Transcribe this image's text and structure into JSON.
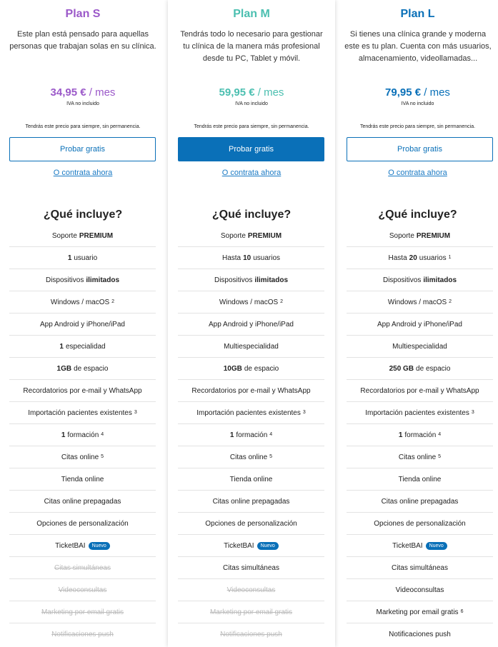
{
  "plans": [
    {
      "key": "s",
      "name": "Plan S",
      "color": "#9b59c9",
      "description_lines": [
        "Este plan está pensado para aquellas",
        "personas que trabajan solas en su clínica."
      ],
      "price": "34,95 €",
      "price_suffix": " / mes",
      "vat": "IVA no incluido",
      "forever": "Tendrás este precio para siempre, sin permanencia.",
      "cta": "Probar gratis",
      "cta_filled": false,
      "contract_link": "O contrata ahora",
      "includes_title": "¿Qué incluye?",
      "features": [
        {
          "pre": "Soporte",
          "bold": "PREMIUM",
          "post": "",
          "sup": "",
          "badge": "",
          "disabled": false
        },
        {
          "pre": "",
          "bold": "1",
          "post": "usuario",
          "sup": "",
          "badge": "",
          "disabled": false
        },
        {
          "pre": "Dispositivos",
          "bold": "ilimitados",
          "post": "",
          "sup": "",
          "badge": "",
          "disabled": false
        },
        {
          "pre": "Windows / macOS",
          "bold": "",
          "post": "",
          "sup": "2",
          "badge": "",
          "disabled": false
        },
        {
          "pre": "App Android y iPhone/iPad",
          "bold": "",
          "post": "",
          "sup": "",
          "badge": "",
          "disabled": false
        },
        {
          "pre": "",
          "bold": "1",
          "post": "especialidad",
          "sup": "",
          "badge": "",
          "disabled": false
        },
        {
          "pre": "",
          "bold": "1GB",
          "post": "de espacio",
          "sup": "",
          "badge": "",
          "disabled": false
        },
        {
          "pre": "Recordatorios por e-mail y WhatsApp",
          "bold": "",
          "post": "",
          "sup": "",
          "badge": "",
          "disabled": false
        },
        {
          "pre": "Importación pacientes existentes",
          "bold": "",
          "post": "",
          "sup": "3",
          "badge": "",
          "disabled": false
        },
        {
          "pre": "",
          "bold": "1",
          "post": "formación",
          "sup": "4",
          "badge": "",
          "disabled": false
        },
        {
          "pre": "Citas online",
          "bold": "",
          "post": "",
          "sup": "5",
          "badge": "",
          "disabled": false
        },
        {
          "pre": "Tienda online",
          "bold": "",
          "post": "",
          "sup": "",
          "badge": "",
          "disabled": false
        },
        {
          "pre": "Citas online prepagadas",
          "bold": "",
          "post": "",
          "sup": "",
          "badge": "",
          "disabled": false
        },
        {
          "pre": "Opciones de personalización",
          "bold": "",
          "post": "",
          "sup": "",
          "badge": "",
          "disabled": false
        },
        {
          "pre": "TicketBAI",
          "bold": "",
          "post": "",
          "sup": "",
          "badge": "Nuevo",
          "disabled": false
        },
        {
          "pre": "Citas simultáneas",
          "bold": "",
          "post": "",
          "sup": "",
          "badge": "",
          "disabled": true
        },
        {
          "pre": "Videoconsultas",
          "bold": "",
          "post": "",
          "sup": "",
          "badge": "",
          "disabled": true
        },
        {
          "pre": "Marketing por email gratis",
          "bold": "",
          "post": "",
          "sup": "",
          "badge": "",
          "disabled": true
        },
        {
          "pre": "Notificaciones push",
          "bold": "",
          "post": "",
          "sup": "",
          "badge": "",
          "disabled": true
        }
      ]
    },
    {
      "key": "m",
      "name": "Plan M",
      "color": "#4bbfb0",
      "description_lines": [
        "Tendrás todo lo necesario para gestionar",
        "tu clínica de la manera más profesional",
        "desde tu PC, Tablet y móvil."
      ],
      "price": "59,95 €",
      "price_suffix": " / mes",
      "vat": "IVA no incluido",
      "forever": "Tendrás este precio para siempre, sin permanencia.",
      "cta": "Probar gratis",
      "cta_filled": true,
      "contract_link": "O contrata ahora",
      "includes_title": "¿Qué incluye?",
      "features": [
        {
          "pre": "Soporte",
          "bold": "PREMIUM",
          "post": "",
          "sup": "",
          "badge": "",
          "disabled": false
        },
        {
          "pre": "Hasta",
          "bold": "10",
          "post": "usuarios",
          "sup": "",
          "badge": "",
          "disabled": false
        },
        {
          "pre": "Dispositivos",
          "bold": "ilimitados",
          "post": "",
          "sup": "",
          "badge": "",
          "disabled": false
        },
        {
          "pre": "Windows / macOS",
          "bold": "",
          "post": "",
          "sup": "2",
          "badge": "",
          "disabled": false
        },
        {
          "pre": "App Android y iPhone/iPad",
          "bold": "",
          "post": "",
          "sup": "",
          "badge": "",
          "disabled": false
        },
        {
          "pre": "Multiespecialidad",
          "bold": "",
          "post": "",
          "sup": "",
          "badge": "",
          "disabled": false
        },
        {
          "pre": "",
          "bold": "10GB",
          "post": "de espacio",
          "sup": "",
          "badge": "",
          "disabled": false
        },
        {
          "pre": "Recordatorios por e-mail y WhatsApp",
          "bold": "",
          "post": "",
          "sup": "",
          "badge": "",
          "disabled": false
        },
        {
          "pre": "Importación pacientes existentes",
          "bold": "",
          "post": "",
          "sup": "3",
          "badge": "",
          "disabled": false
        },
        {
          "pre": "",
          "bold": "1",
          "post": "formación",
          "sup": "4",
          "badge": "",
          "disabled": false
        },
        {
          "pre": "Citas online",
          "bold": "",
          "post": "",
          "sup": "5",
          "badge": "",
          "disabled": false
        },
        {
          "pre": "Tienda online",
          "bold": "",
          "post": "",
          "sup": "",
          "badge": "",
          "disabled": false
        },
        {
          "pre": "Citas online prepagadas",
          "bold": "",
          "post": "",
          "sup": "",
          "badge": "",
          "disabled": false
        },
        {
          "pre": "Opciones de personalización",
          "bold": "",
          "post": "",
          "sup": "",
          "badge": "",
          "disabled": false
        },
        {
          "pre": "TicketBAI",
          "bold": "",
          "post": "",
          "sup": "",
          "badge": "Nuevo",
          "disabled": false
        },
        {
          "pre": "Citas simultáneas",
          "bold": "",
          "post": "",
          "sup": "",
          "badge": "",
          "disabled": false
        },
        {
          "pre": "Videoconsultas",
          "bold": "",
          "post": "",
          "sup": "",
          "badge": "",
          "disabled": true
        },
        {
          "pre": "Marketing por email gratis",
          "bold": "",
          "post": "",
          "sup": "",
          "badge": "",
          "disabled": true
        },
        {
          "pre": "Notificaciones push",
          "bold": "",
          "post": "",
          "sup": "",
          "badge": "",
          "disabled": true
        }
      ]
    },
    {
      "key": "l",
      "name": "Plan L",
      "color": "#0a70b8",
      "description_lines": [
        "Si tienes una clínica grande y moderna",
        "este es tu plan. Cuenta con más usuarios,",
        "almacenamiento, videollamadas..."
      ],
      "price": "79,95 €",
      "price_suffix": " / mes",
      "vat": "IVA no incluido",
      "forever": "Tendrás este precio para siempre, sin permanencia.",
      "cta": "Probar gratis",
      "cta_filled": false,
      "contract_link": "O contrata ahora",
      "includes_title": "¿Qué incluye?",
      "features": [
        {
          "pre": "Soporte",
          "bold": "PREMIUM",
          "post": "",
          "sup": "",
          "badge": "",
          "disabled": false
        },
        {
          "pre": "Hasta",
          "bold": "20",
          "post": "usuarios",
          "sup": "1",
          "badge": "",
          "disabled": false
        },
        {
          "pre": "Dispositivos",
          "bold": "ilimitados",
          "post": "",
          "sup": "",
          "badge": "",
          "disabled": false
        },
        {
          "pre": "Windows / macOS",
          "bold": "",
          "post": "",
          "sup": "2",
          "badge": "",
          "disabled": false
        },
        {
          "pre": "App Android y iPhone/iPad",
          "bold": "",
          "post": "",
          "sup": "",
          "badge": "",
          "disabled": false
        },
        {
          "pre": "Multiespecialidad",
          "bold": "",
          "post": "",
          "sup": "",
          "badge": "",
          "disabled": false
        },
        {
          "pre": "",
          "bold": "250 GB",
          "post": "de espacio",
          "sup": "",
          "badge": "",
          "disabled": false
        },
        {
          "pre": "Recordatorios por e-mail y WhatsApp",
          "bold": "",
          "post": "",
          "sup": "",
          "badge": "",
          "disabled": false
        },
        {
          "pre": "Importación pacientes existentes",
          "bold": "",
          "post": "",
          "sup": "3",
          "badge": "",
          "disabled": false
        },
        {
          "pre": "",
          "bold": "1",
          "post": "formación",
          "sup": "4",
          "badge": "",
          "disabled": false
        },
        {
          "pre": "Citas online",
          "bold": "",
          "post": "",
          "sup": "5",
          "badge": "",
          "disabled": false
        },
        {
          "pre": "Tienda online",
          "bold": "",
          "post": "",
          "sup": "",
          "badge": "",
          "disabled": false
        },
        {
          "pre": "Citas online prepagadas",
          "bold": "",
          "post": "",
          "sup": "",
          "badge": "",
          "disabled": false
        },
        {
          "pre": "Opciones de personalización",
          "bold": "",
          "post": "",
          "sup": "",
          "badge": "",
          "disabled": false
        },
        {
          "pre": "TicketBAI",
          "bold": "",
          "post": "",
          "sup": "",
          "badge": "Nuevo",
          "disabled": false
        },
        {
          "pre": "Citas simultáneas",
          "bold": "",
          "post": "",
          "sup": "",
          "badge": "",
          "disabled": false
        },
        {
          "pre": "Videoconsultas",
          "bold": "",
          "post": "",
          "sup": "",
          "badge": "",
          "disabled": false
        },
        {
          "pre": "Marketing por email gratis",
          "bold": "",
          "post": "",
          "sup": "6",
          "badge": "",
          "disabled": false
        },
        {
          "pre": "Notificaciones push",
          "bold": "",
          "post": "",
          "sup": "",
          "badge": "",
          "disabled": false
        }
      ]
    }
  ]
}
